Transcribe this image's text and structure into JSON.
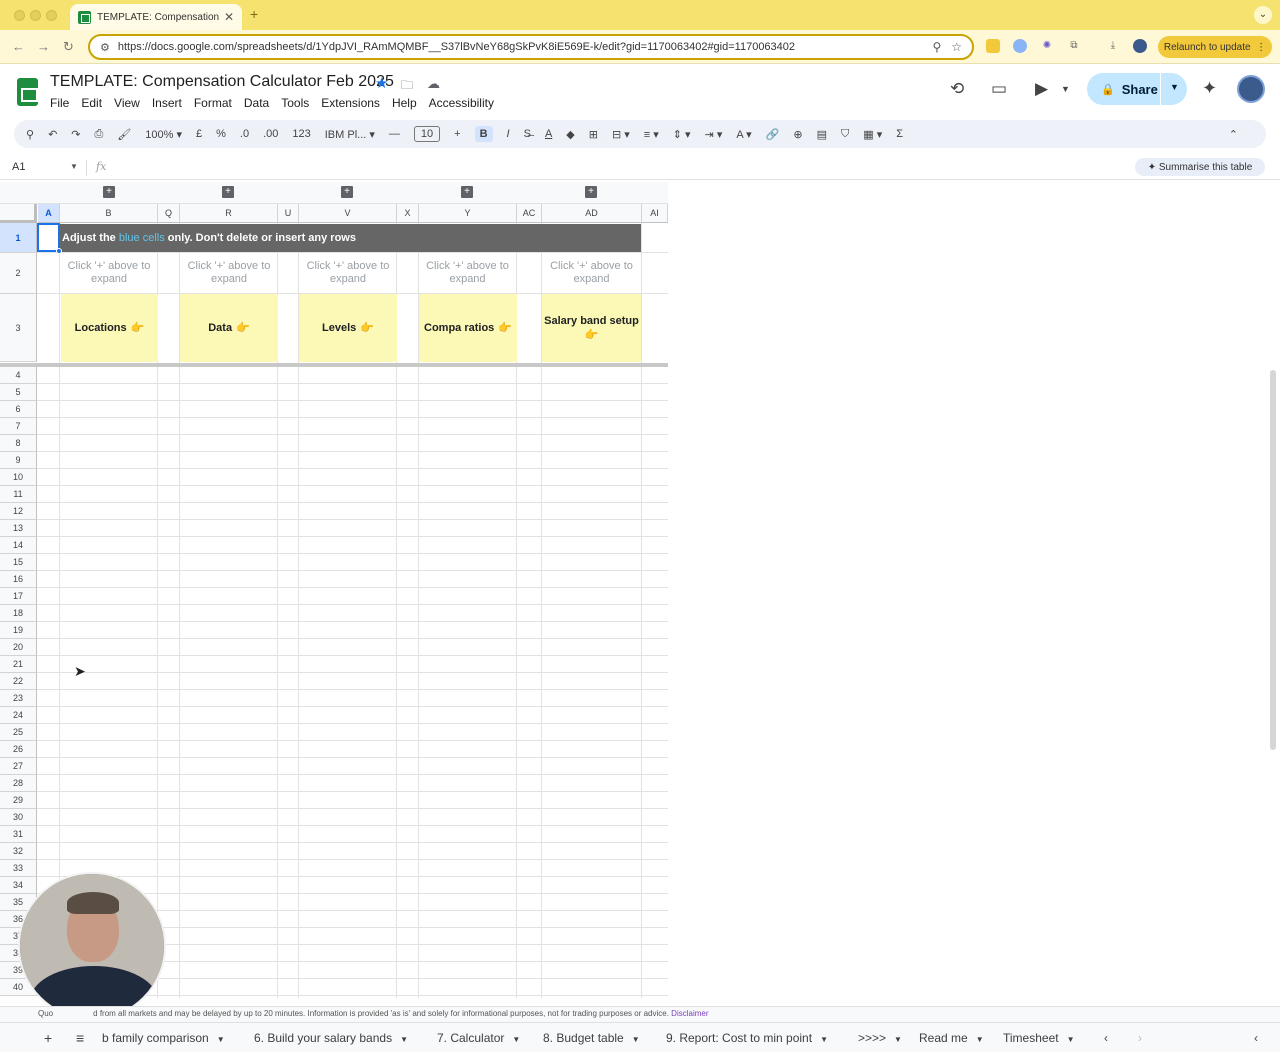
{
  "browser": {
    "tab_title": "TEMPLATE: Compensation C",
    "url": "https://docs.google.com/spreadsheets/d/1YdpJVI_RAmMQMBF__S37lBvNeY68gSkPvK8iE569E-k/edit?gid=1170063402#gid=1170063402",
    "relaunch_label": "Relaunch to update"
  },
  "doc": {
    "title": "TEMPLATE: Compensation Calculator Feb 2025",
    "menu": [
      "File",
      "Edit",
      "View",
      "Insert",
      "Format",
      "Data",
      "Tools",
      "Extensions",
      "Help",
      "Accessibility"
    ],
    "share_label": "Share"
  },
  "toolbar": {
    "zoom": "100%",
    "currency": "£",
    "percent": "%",
    "dec_decrease": ".0",
    "dec_increase": ".00",
    "number_format": "123",
    "font": "IBM Pl...",
    "font_size": "10",
    "bold": "B",
    "italic": "I"
  },
  "formula_bar": {
    "name_box": "A1",
    "fx": "fx",
    "summarise_label": "Summarise this table"
  },
  "grid": {
    "columns": [
      "A",
      "B",
      "Q",
      "R",
      "U",
      "V",
      "X",
      "Y",
      "AC",
      "AD",
      "AI"
    ],
    "rows": [
      "1",
      "2",
      "3",
      "4",
      "5",
      "6",
      "7",
      "8",
      "9",
      "10",
      "11",
      "12",
      "13",
      "14",
      "15",
      "16",
      "17",
      "18",
      "19",
      "20",
      "21",
      "22",
      "23",
      "24",
      "25",
      "26",
      "27",
      "28",
      "29",
      "30",
      "31",
      "32",
      "33",
      "34",
      "35",
      "36",
      "37",
      "38",
      "39",
      "40"
    ],
    "banner": {
      "prefix": "Adjust the ",
      "highlight": "blue cells",
      "suffix": " only. Don't delete or insert any rows"
    },
    "hint_line1": "Click '+' above to",
    "hint_line2": "expand",
    "sections": [
      {
        "label": "Locations",
        "emoji": "👉"
      },
      {
        "label": "Data",
        "emoji": "👉"
      },
      {
        "label": "Levels",
        "emoji": "👉"
      },
      {
        "label": "Compa ratios",
        "emoji": "👉"
      },
      {
        "label": "Salary band setup",
        "emoji": "👉"
      }
    ]
  },
  "footer": {
    "disclaimer_prefix": "Quo",
    "disclaimer_text": "d from all markets and may be delayed by up to 20 minutes. Information is provided 'as is' and solely for informational purposes, not for trading purposes or advice.",
    "disclaimer_link": "Disclaimer",
    "sheet_tabs": [
      "b family comparison",
      "6. Build your salary bands",
      "7. Calculator",
      "8. Budget table",
      "9. Report: Cost to min point",
      ">>>>",
      "Read me",
      "Timesheet"
    ]
  },
  "colors": {
    "accent": "#1a73e8",
    "banner_bg": "#666666",
    "section_bg": "#fbf9b5",
    "blue_text": "#5ec6e8"
  }
}
